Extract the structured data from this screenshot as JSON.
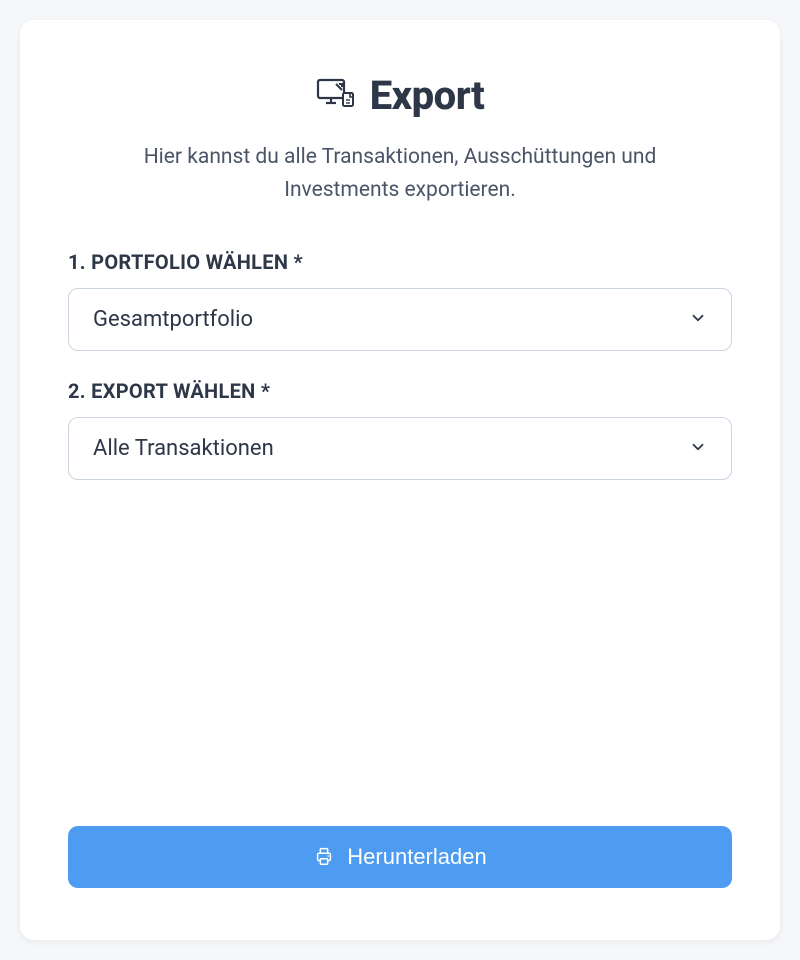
{
  "header": {
    "title": "Export",
    "subtitle": "Hier kannst du alle Transaktionen, Ausschüttungen und Investments exportieren."
  },
  "fields": {
    "portfolio": {
      "label": "1. PORTFOLIO WÄHLEN *",
      "value": "Gesamtportfolio"
    },
    "export": {
      "label": "2. EXPORT WÄHLEN *",
      "value": "Alle Transaktionen"
    }
  },
  "actions": {
    "download_label": "Herunterladen"
  },
  "colors": {
    "primary": "#4d9cf2",
    "text_dark": "#2d3748",
    "text_muted": "#4a5568",
    "border": "#cbd5e0"
  }
}
